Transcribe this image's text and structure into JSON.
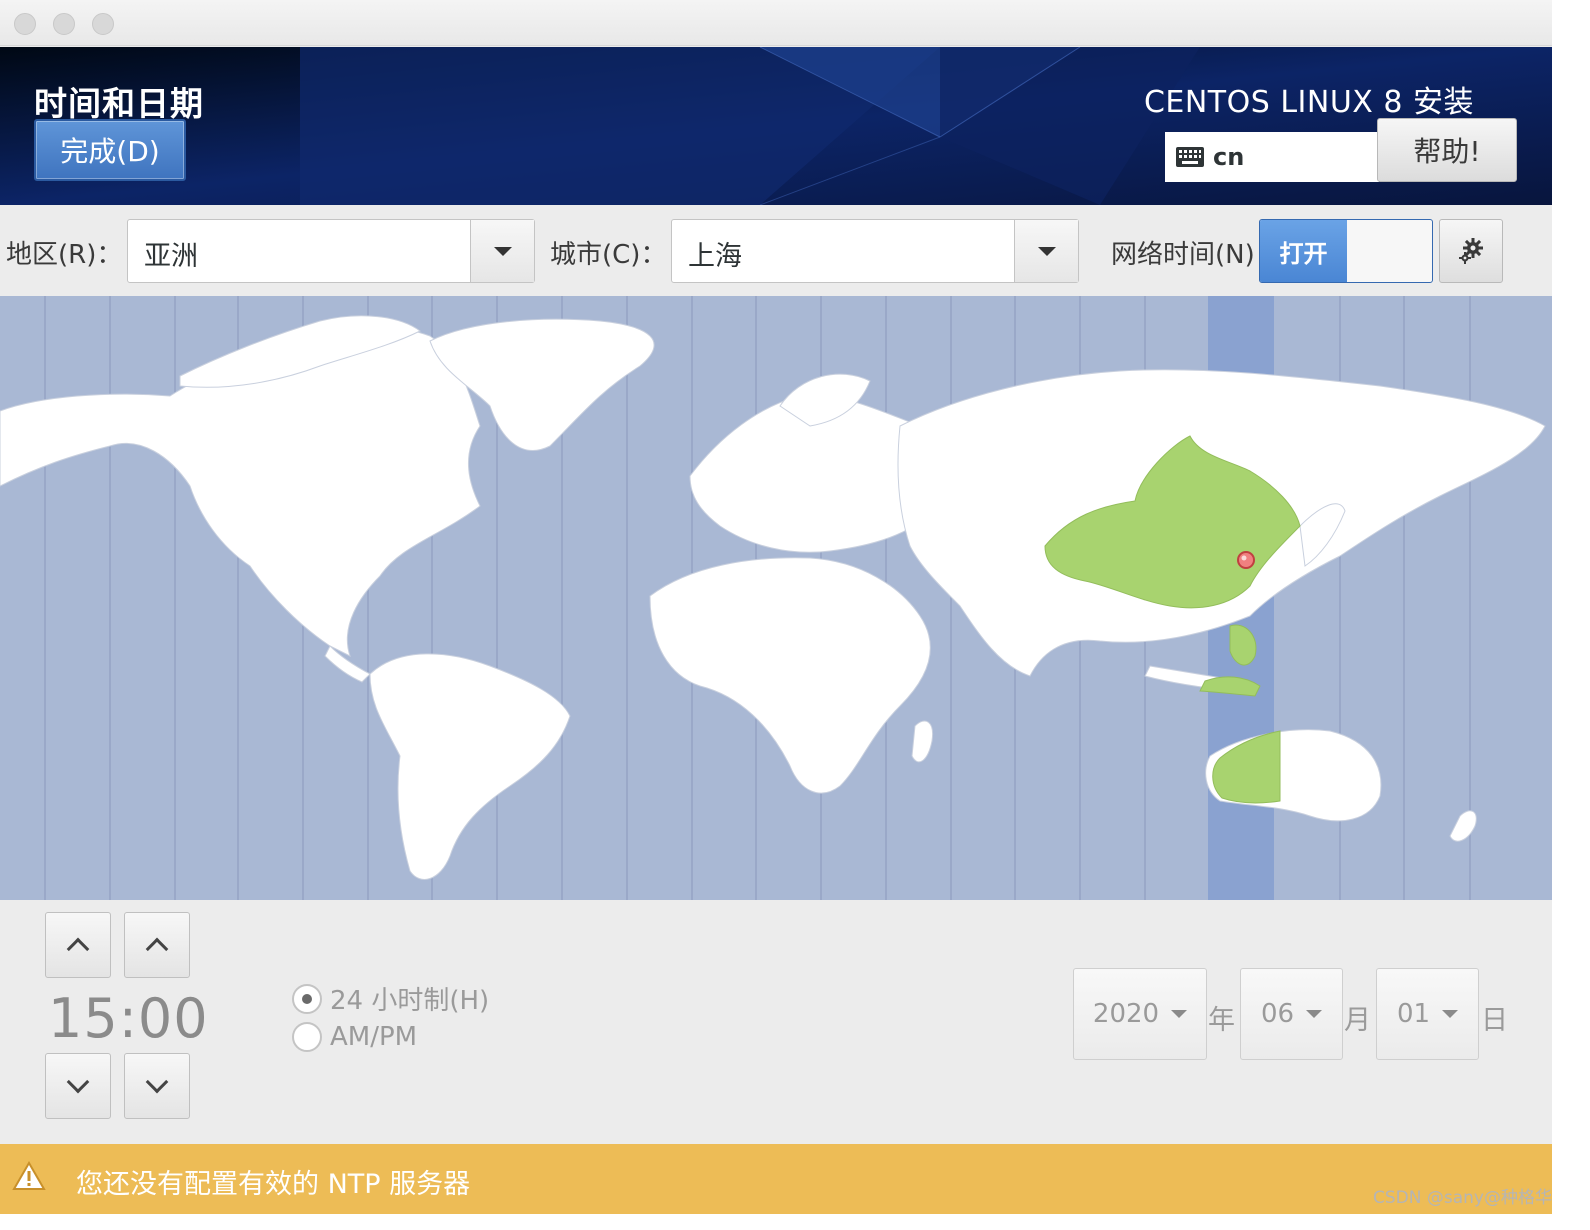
{
  "window": {
    "header_title": "时间和日期",
    "done_label": "完成(D)",
    "install_title": "CENTOS LINUX 8 安装",
    "keyboard_layout": "cn",
    "help_label": "帮助!"
  },
  "toolbar": {
    "region_label": "地区(R)：",
    "region_value": "亚洲",
    "city_label": "城市(C)：",
    "city_value": "上海",
    "network_time_label": "网络时间(N)",
    "network_time_state": "打开"
  },
  "time": {
    "display": "15:00",
    "format_24h": "24 小时制(H)",
    "format_ampm": "AM/PM",
    "selected_format": "24h"
  },
  "date": {
    "year": "2020",
    "year_unit": "年",
    "month": "06",
    "month_unit": "月",
    "day": "01",
    "day_unit": "日"
  },
  "warning": {
    "text": "您还没有配置有效的 NTP 服务器"
  },
  "watermark": "CSDN @sany@种格华",
  "colors": {
    "accent": "#4a86d4",
    "header_bg": "#0b1a45",
    "map_ocean": "#a9b8d4",
    "timezone_highlight": "#8aa2d0",
    "selected_country": "#a8d36f",
    "warning_bg": "#edbc56"
  }
}
